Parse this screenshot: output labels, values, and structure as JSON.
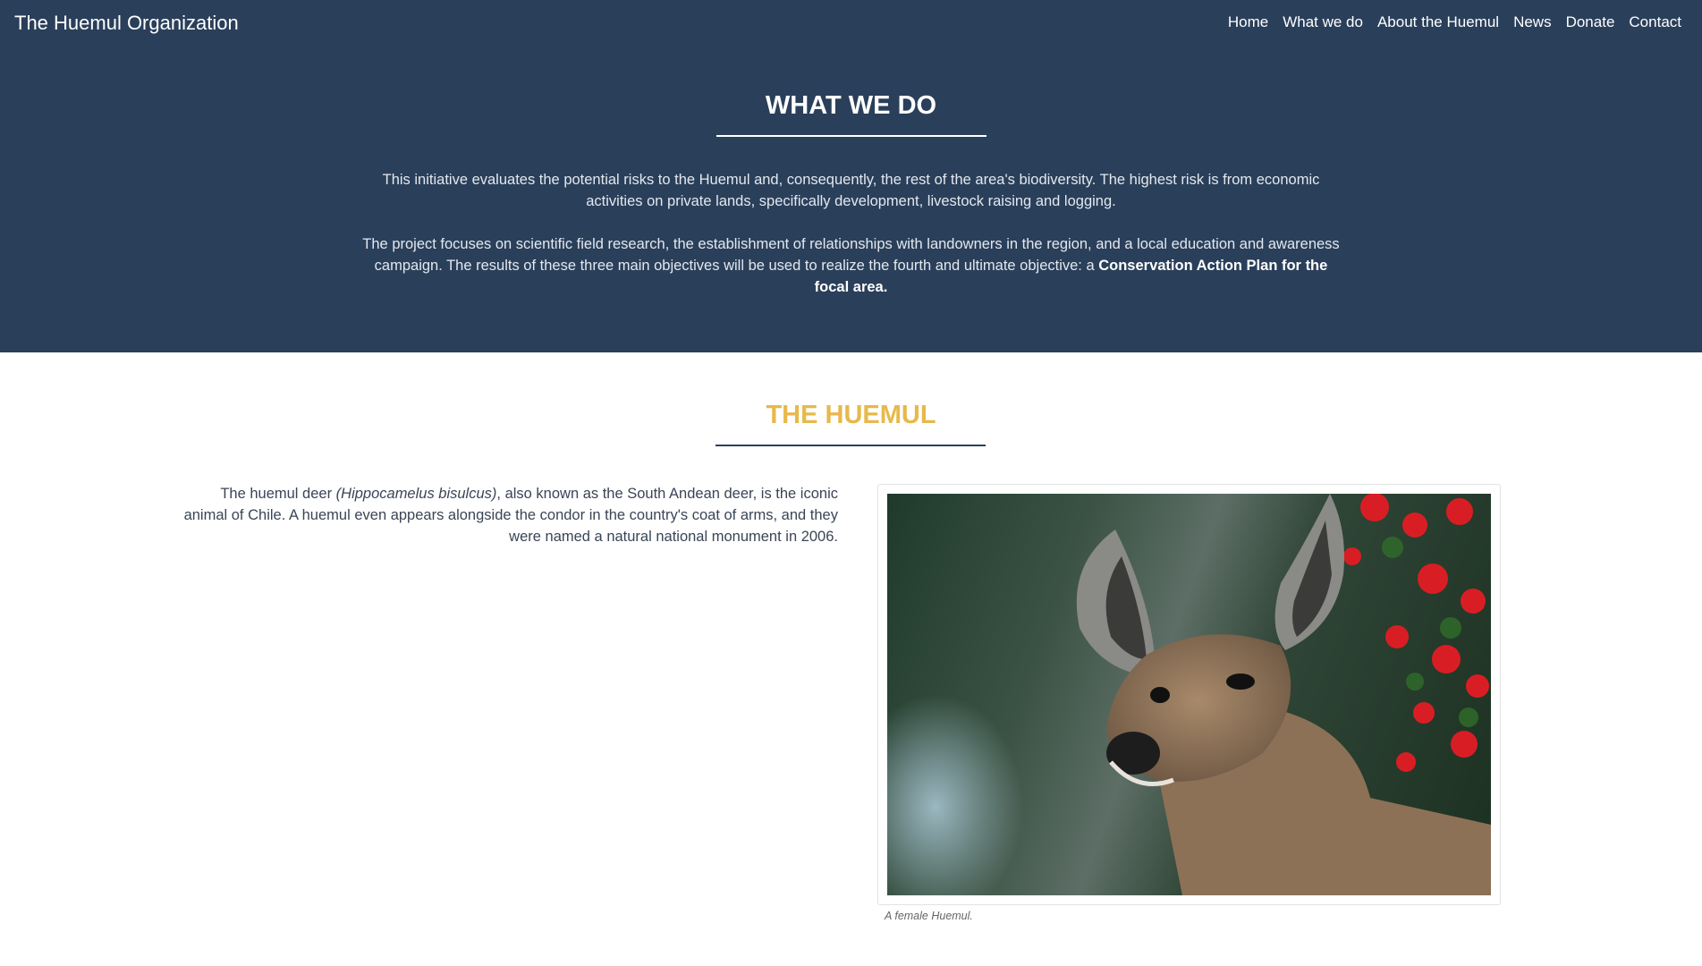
{
  "brand": "The Huemul Organization",
  "nav": {
    "items": [
      {
        "label": "Home"
      },
      {
        "label": "What we do"
      },
      {
        "label": "About the Huemul"
      },
      {
        "label": "News"
      },
      {
        "label": "Donate"
      },
      {
        "label": "Contact"
      }
    ]
  },
  "what_we_do": {
    "heading": "WHAT WE DO",
    "paragraph1": "This initiative evaluates the potential risks to the Huemul and, consequently, the rest of the area's biodiversity. The highest risk is from economic activities on private lands, specifically development, livestock raising and logging.",
    "paragraph2": "The project focuses on scientific field research, the establishment of relationships with landowners in the region, and a local education and awareness campaign. The results of these three main objectives will be used to realize the fourth and ultimate objective: a ",
    "paragraph2_bold": "Conservation Action Plan for the focal area."
  },
  "huemul": {
    "heading": "THE HUEMUL",
    "text_before": "The huemul deer ",
    "scientific_name": "(Hippocamelus bisulcus)",
    "text_after": ", also known as the South Andean deer, is the iconic animal of Chile. A huemul even appears alongside the condor in the country's coat of arms, and they were named a natural national monument in 2006.",
    "image_caption": "A female Huemul."
  },
  "colors": {
    "header_bg": "#2a3f5a",
    "accent_gold": "#e7b94c",
    "text_dark": "#3a4556"
  }
}
